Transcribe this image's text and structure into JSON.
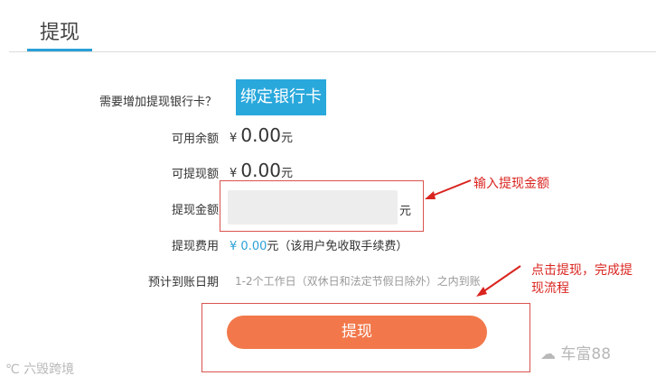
{
  "header": {
    "title": "提现"
  },
  "form": {
    "add_card_label": "需要增加提现银行卡？",
    "add_card_button": "绑定银行卡",
    "available_label": "可用余额",
    "available_currency": "¥",
    "available_amount": "0.00",
    "available_unit": "元",
    "withdrawable_label": "可提现额",
    "withdrawable_currency": "¥",
    "withdrawable_amount": "0.00",
    "withdrawable_unit": "元",
    "amount_label": "提现金额",
    "amount_value": "",
    "amount_unit": "元",
    "fee_label": "提现费用",
    "fee_currency": "¥",
    "fee_amount": "0.00",
    "fee_unit": "元",
    "fee_note": "（该用户免收取手续费）",
    "date_label": "预计到账日期",
    "date_value": "1-2个工作日（双休日和法定节假日除外）之内到账",
    "submit_button": "提现"
  },
  "annotations": {
    "amount_hint": "输入提现金额",
    "submit_hint_line1": "点击提现，完成提",
    "submit_hint_line2": "现流程"
  },
  "watermarks": {
    "left": "六毁跨境",
    "right": "车富88"
  },
  "colors": {
    "accent": "#2aa0d8",
    "submit": "#f2784b",
    "annotation": "#d9241f"
  }
}
